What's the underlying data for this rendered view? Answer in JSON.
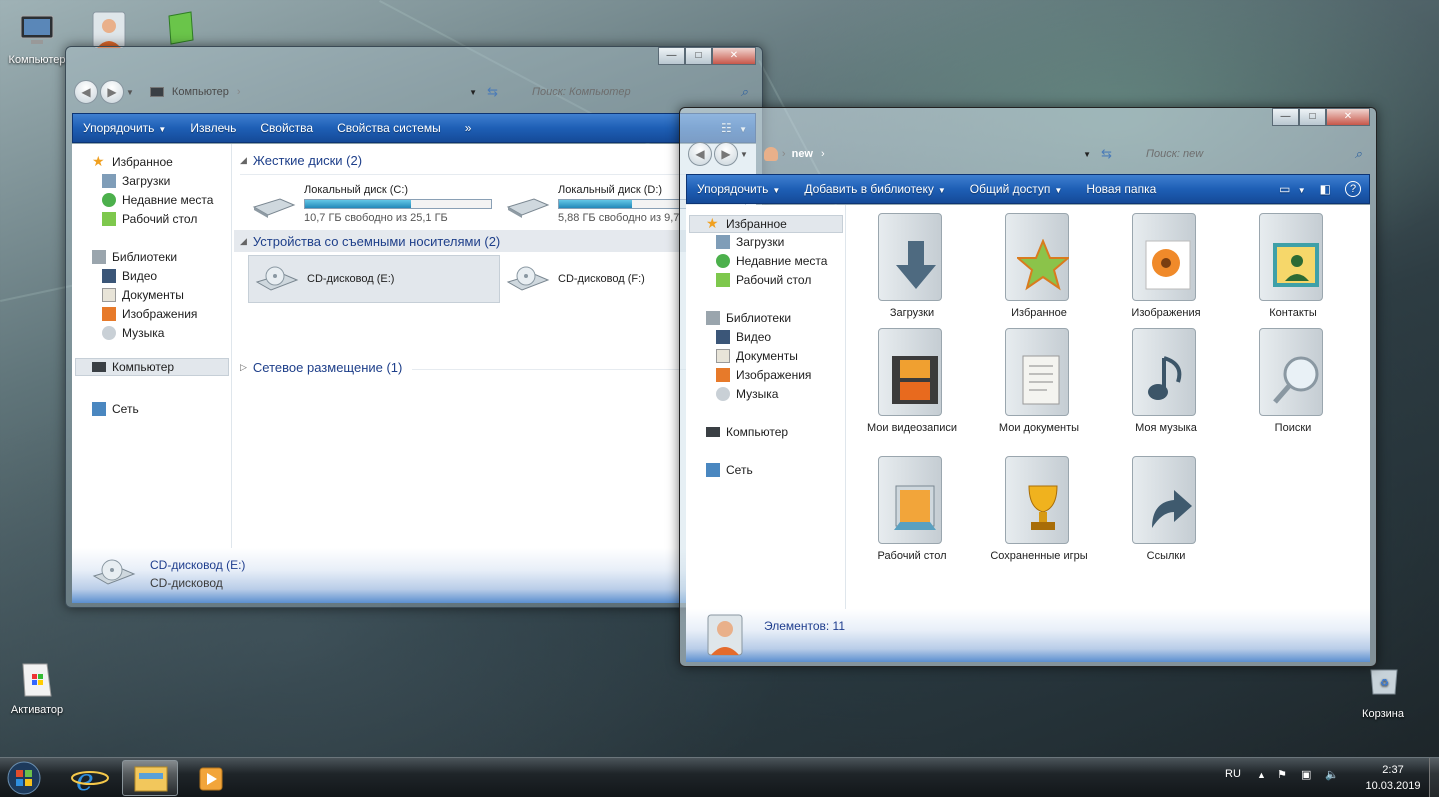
{
  "desktop": {
    "icons": [
      {
        "label": "Компьютер"
      },
      {
        "label": ""
      },
      {
        "label": ""
      },
      {
        "label": "Активатор"
      },
      {
        "label": "Корзина"
      }
    ]
  },
  "win1": {
    "address": "Компьютер",
    "search_placeholder": "Поиск: Компьютер",
    "toolbar": [
      "Упорядочить",
      "Извлечь",
      "Свойства",
      "Свойства системы"
    ],
    "toolbar_more": "»",
    "nav": {
      "favorites": "Избранное",
      "downloads": "Загрузки",
      "recent": "Недавние места",
      "desktop": "Рабочий стол",
      "libraries": "Библиотеки",
      "video": "Видео",
      "documents": "Документы",
      "pictures": "Изображения",
      "music": "Музыка",
      "computer": "Компьютер",
      "network": "Сеть"
    },
    "groups": {
      "hdd": "Жесткие диски (2)",
      "removable": "Устройства со съемными носителями (2)",
      "network": "Сетевое размещение (1)"
    },
    "drives": [
      {
        "name": "Локальный диск (C:)",
        "free": "10,7 ГБ свободно из 25,1 ГБ",
        "used_fraction": 0.57
      },
      {
        "name": "Локальный диск (D:)",
        "free": "5,88 ГБ свободно из 9,7",
        "used_fraction": 0.39
      }
    ],
    "removables": [
      {
        "name": "CD-дисковод (E:)"
      },
      {
        "name": "CD-дисковод (F:)"
      }
    ],
    "status": {
      "name": "CD-дисковод (E:)",
      "type": "CD-дисковод"
    }
  },
  "win2": {
    "address": "new",
    "search_placeholder": "Поиск: new",
    "toolbar": [
      "Упорядочить",
      "Добавить в библиотеку",
      "Общий доступ",
      "Новая папка"
    ],
    "nav": {
      "favorites": "Избранное",
      "downloads": "Загрузки",
      "recent": "Недавние места",
      "desktop": "Рабочий стол",
      "libraries": "Библиотеки",
      "video": "Видео",
      "documents": "Документы",
      "pictures": "Изображения",
      "music": "Музыка",
      "computer": "Компьютер",
      "network": "Сеть"
    },
    "folders": [
      {
        "label": "Загрузки"
      },
      {
        "label": "Избранное"
      },
      {
        "label": "Изображения"
      },
      {
        "label": "Контакты"
      },
      {
        "label": "Мои видеозаписи"
      },
      {
        "label": "Мои документы"
      },
      {
        "label": "Моя музыка"
      },
      {
        "label": "Поиски"
      },
      {
        "label": "Рабочий стол"
      },
      {
        "label": "Сохраненные игры"
      },
      {
        "label": "Ссылки"
      }
    ],
    "status": "Элементов: 11"
  },
  "taskbar": {
    "lang": "RU",
    "time": "2:37",
    "date": "10.03.2019"
  }
}
